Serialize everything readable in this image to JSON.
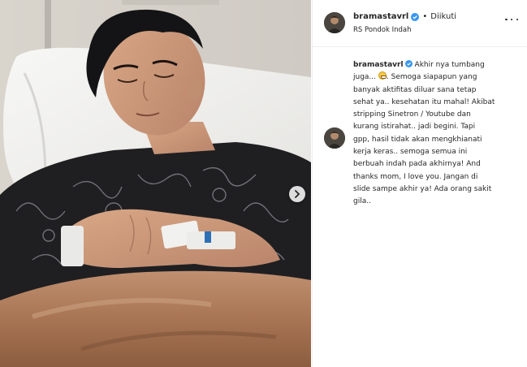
{
  "post": {
    "username": "bramastavrl",
    "follow_status": "Diikuti",
    "dot": "•",
    "location": "RS Pondok Indah"
  },
  "caption": {
    "username": "bramastavrl",
    "lines": [
      "Akhir nya tumbang",
      "juga...",
      "Semoga siapapun yang",
      "banyak aktifitas diluar sana tetap",
      "sehat ya.. kesehatan itu mahal! Akibat",
      "stripping Sinetron / Youtube dan",
      "kurang istirahat.. jadi begini. Tapi",
      "gpp, hasil tidak akan mengkhianati",
      "kerja keras.. semoga semua ini",
      "berbuah indah pada akhirnya! And",
      "thanks mom, I love you. Jangan di",
      "slide sampe akhir ya! Ada orang sakit",
      "gila.."
    ],
    "emoji": "grimacing-face"
  },
  "colors": {
    "verified": "#3897f0",
    "text": "#262626",
    "divider": "#efefef"
  },
  "icons": {
    "verified": "verified-badge-icon",
    "more": "more-options-icon",
    "next": "chevron-right-icon"
  }
}
